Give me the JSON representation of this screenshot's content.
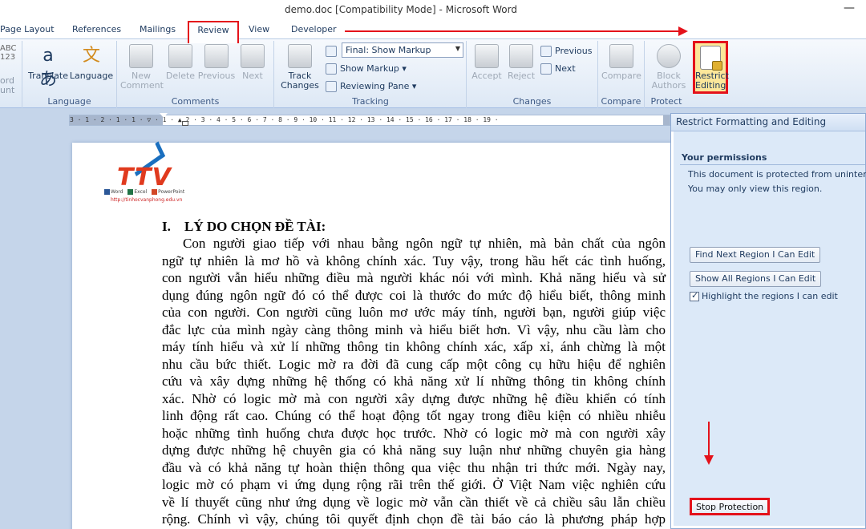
{
  "window": {
    "title": "demo.doc [Compatibility Mode]  -  Microsoft Word",
    "minimize_glyph": "—"
  },
  "tabs": [
    "Page Layout",
    "References",
    "Mailings",
    "Review",
    "View",
    "Developer"
  ],
  "active_tab": "Review",
  "ribbon": {
    "proofing": {
      "word_count_top": "ord",
      "word_count_bottom": "unt",
      "abc_icon": "ABC\n123"
    },
    "language": {
      "label": "Language",
      "translate": "Translate",
      "language": "Language"
    },
    "comments": {
      "label": "Comments",
      "new_comment": "New\nComment",
      "delete": "Delete",
      "previous": "Previous",
      "next": "Next"
    },
    "tracking": {
      "label": "Tracking",
      "track_changes": "Track\nChanges",
      "final_markup": "Final: Show Markup",
      "show_markup": "Show Markup",
      "reviewing_pane": "Reviewing Pane"
    },
    "changes": {
      "label": "Changes",
      "accept": "Accept",
      "reject": "Reject",
      "previous": "Previous",
      "next": "Next"
    },
    "compare": {
      "label": "Compare",
      "compare": "Compare"
    },
    "protect": {
      "label": "Protect",
      "block_authors": "Block\nAuthors",
      "restrict_editing": "Restrict\nEditing"
    }
  },
  "ruler": {
    "ticks": "3 · 1 · 2 · 1 · 1 · ▽ · 1 · ▲ 2 · 3 · 4 · 5 · 6 · 7 · 8 · 9 · 10 · 11 · 12 · 13 · 14 · 15 · 16 · 17 · 18 · 19 ·"
  },
  "document": {
    "logo": {
      "text": "TTV",
      "apps": [
        "Word",
        "Excel",
        "PowerPoint"
      ],
      "url": "http://tinhocvanphong.edu.vn"
    },
    "heading_num": "I.",
    "heading": "LÝ DO CHỌN ĐỀ TÀI:",
    "lines": [
      "Con người giao tiếp với nhau bằng ngôn ngữ tự nhiên, mà bản chất của ngôn",
      "ngữ tự nhiên là mơ hồ và không chính xác. Tuy vậy, trong hầu hết các tình huống,",
      "con người vẫn hiểu những điều mà người khác nói với mình. Khả năng hiểu và sử",
      "dụng đúng ngôn ngữ đó có thể được coi là thước đo mức độ hiểu biết, thông minh",
      "của con người. Con người cũng luôn mơ ước máy tính, người bạn, người giúp việc",
      "đắc lực của mình ngày càng thông minh và hiểu biết hơn. Vì vậy, nhu cầu làm cho",
      "máy tính hiểu và xử lí những thông tin không chính xác, xấp xỉ, ánh chừng là một",
      "nhu cầu bức thiết. Logic mờ ra đời đã cung cấp một công cụ hữu hiệu để nghiên",
      "cứu và xây dựng những hệ thống có khả năng xử lí những thông tin không chính",
      "xác. Nhờ có logic mờ mà con người xây dựng được những hệ điều khiển có tính",
      "linh động rất cao. Chúng có thể hoạt động tốt ngay trong điều kiện có nhiều nhiễu",
      "hoặc những tình huống chưa được học trước. Nhờ có logic mờ mà con người xây",
      "dựng được những hệ chuyên gia có khả năng suy luận như những chuyên gia hàng",
      "đầu và có khả năng tự hoàn thiện thông qua việc thu nhận tri thức mới. Ngày nay,",
      "logic mờ có phạm vi ứng dụng rộng rãi trên thế giới. Ở Việt Nam việc nghiên cứu",
      "về lí thuyết cũng như ứng dụng về logic mờ vẫn cần thiết về cả chiều sâu lẫn chiều",
      "rộng. Chính vì vậy, chúng tôi quyết định chọn đề tài báo cáo là phương pháp hợp"
    ]
  },
  "pane": {
    "title": "Restrict Formatting and Editing",
    "section_title": "Your permissions",
    "message_1": "This document is protected from unintentional e",
    "message_2": "You may only view this region.",
    "find_next": "Find Next Region I Can Edit",
    "show_all": "Show All Regions I Can Edit",
    "highlight_label": "Highlight the regions I can edit",
    "highlight_checked": true,
    "stop_protection": "Stop Protection"
  },
  "colors": {
    "annotation_red": "#e4121b",
    "ribbon_bg": "#dde8f5",
    "pane_bg": "#dce9f8"
  }
}
